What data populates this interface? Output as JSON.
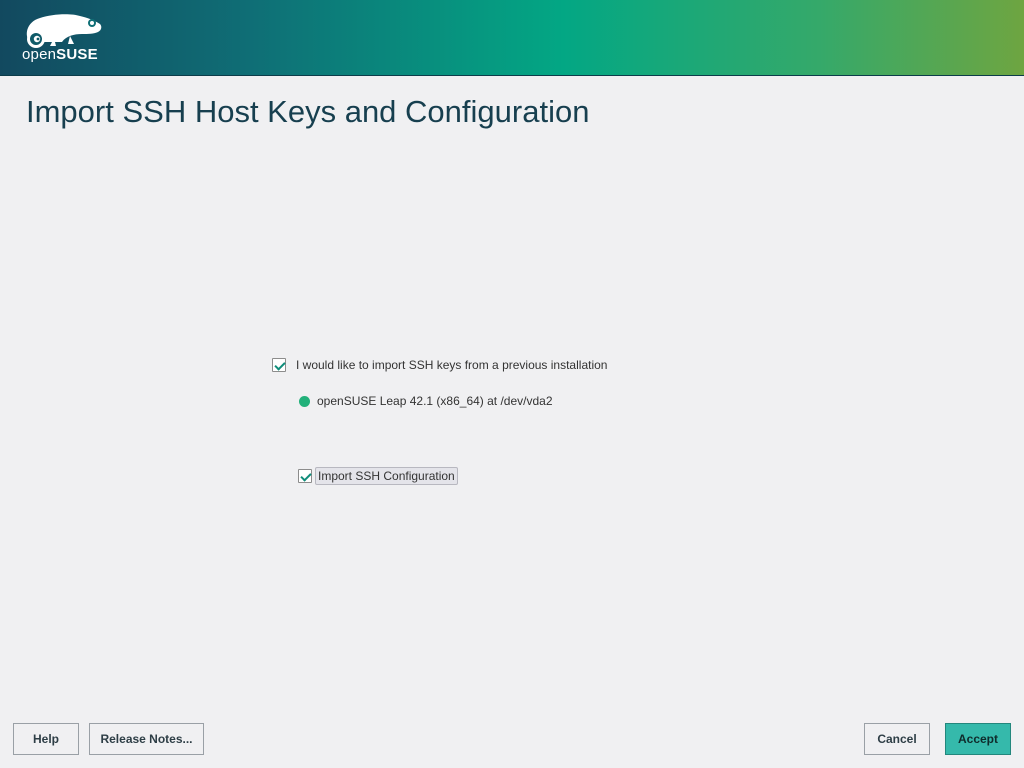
{
  "header": {
    "logo_text_light": "open",
    "logo_text_bold": "SUSE",
    "colors": {
      "banner_start": "#12495f",
      "banner_mid": "#03a784",
      "banner_end": "#6ea541"
    }
  },
  "page": {
    "title": "Import SSH Host Keys and Configuration"
  },
  "options": {
    "import_keys_label": "I would like to import SSH keys from a previous installation",
    "import_keys_checked": true,
    "installation_label": "openSUSE Leap 42.1 (x86_64) at /dev/vda2",
    "installation_selected": true,
    "import_config_label": "Import SSH Configuration",
    "import_config_checked": true
  },
  "buttons": {
    "help": "Help",
    "release_notes": "Release Notes...",
    "cancel": "Cancel",
    "accept": "Accept"
  },
  "colors": {
    "accent": "#35b9ab",
    "radio": "#22b07a",
    "title": "#173f4f"
  }
}
